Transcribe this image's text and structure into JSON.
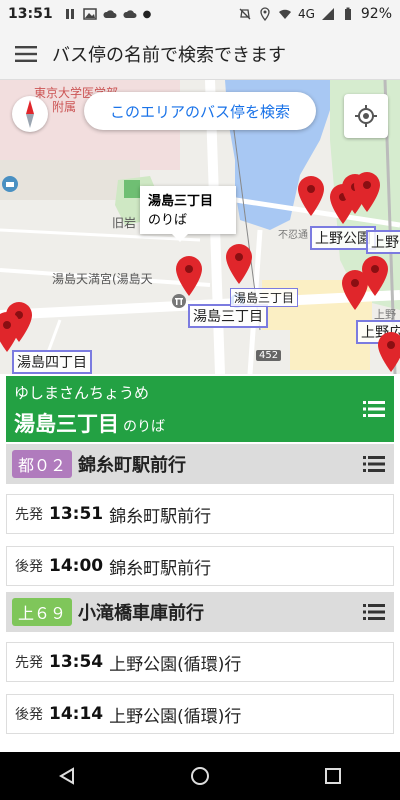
{
  "status_bar": {
    "time": "13:51",
    "network": "4G",
    "battery": "92%"
  },
  "app_bar": {
    "title": "バス停の名前で検索できます"
  },
  "map": {
    "search_area_button": "このエリアのバス停を検索",
    "info_window": {
      "name": "湯島三丁目",
      "sub": "のりば"
    },
    "stop_labels": [
      "湯島三丁目",
      "上野公園",
      "上野公園",
      "湯島四丁目",
      "上野広",
      "湯島三丁目"
    ],
    "map_labels": [
      "附属",
      "東京大学医学部",
      "旧岩",
      "湯島天満宮(湯島天",
      "不忍通",
      "上野",
      "452"
    ]
  },
  "stop": {
    "kana": "ゆしまさんちょうめ",
    "name": "湯島三丁目",
    "suffix": "のりば"
  },
  "routes": [
    {
      "badge": "都０２",
      "badge_color": "#b07bbd",
      "destination": "錦糸町駅前行",
      "departures": [
        {
          "label": "先発",
          "time": "13:51",
          "destination": "錦糸町駅前行"
        },
        {
          "label": "後発",
          "time": "14:00",
          "destination": "錦糸町駅前行"
        }
      ]
    },
    {
      "badge": "上６９",
      "badge_color": "#7fc65a",
      "destination": "小滝橋車庫前行",
      "departures": [
        {
          "label": "先発",
          "time": "13:54",
          "destination": "上野公園(循環)行"
        },
        {
          "label": "後発",
          "time": "14:14",
          "destination": "上野公園(循環)行"
        }
      ]
    }
  ],
  "colors": {
    "header_green": "#23a143",
    "pin_red": "#e0262b",
    "stop_label_border": "#7b7be0",
    "link_blue": "#1a73e8"
  }
}
